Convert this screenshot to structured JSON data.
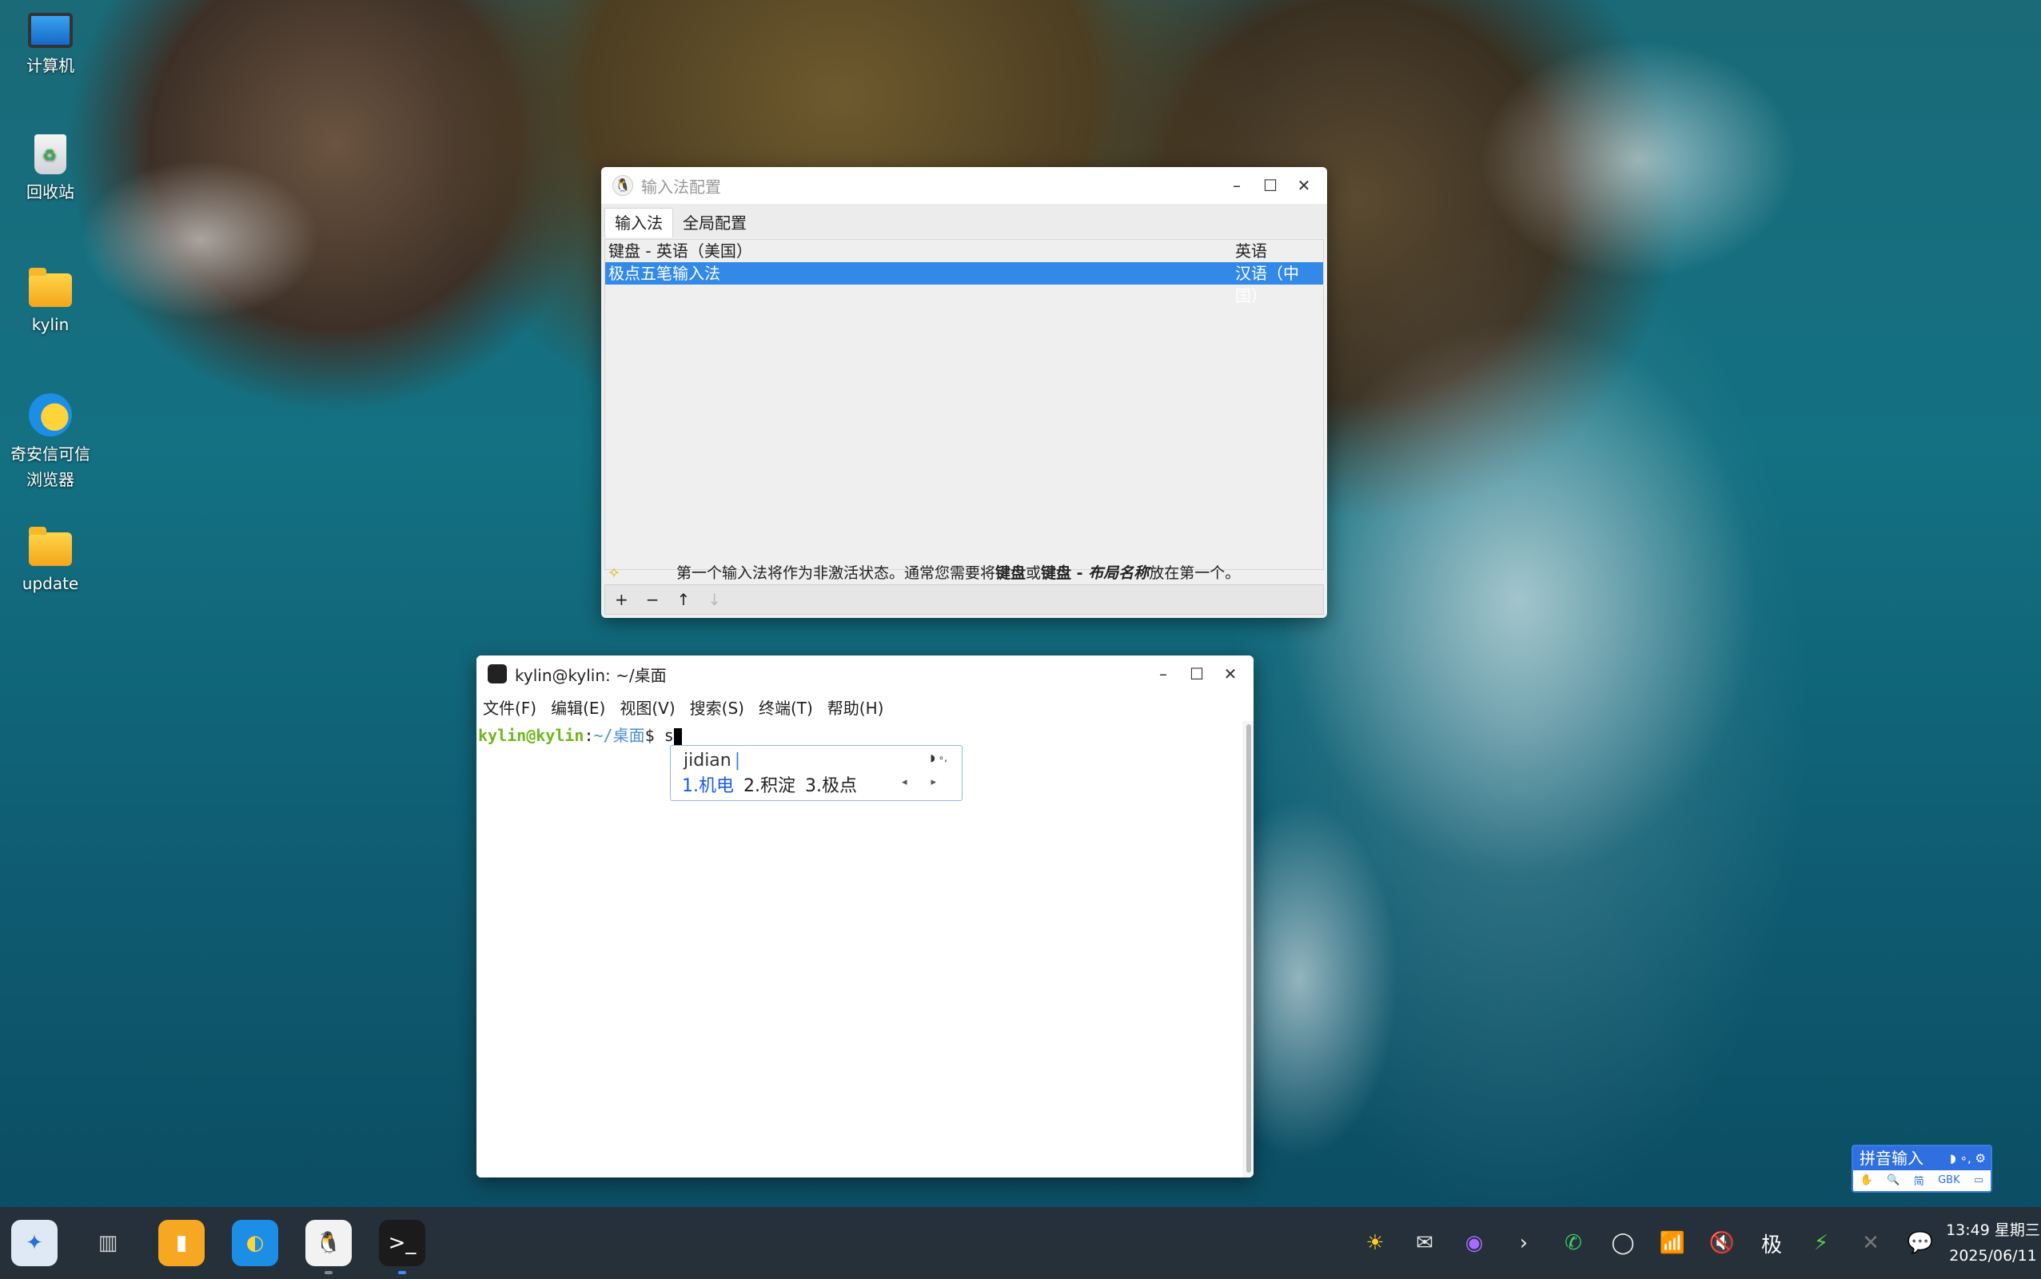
{
  "desktop": {
    "icons": [
      {
        "label": "计算机",
        "icon": "computer-icon"
      },
      {
        "label": "回收站",
        "icon": "trash-icon"
      },
      {
        "label": "kylin",
        "icon": "folder-icon"
      },
      {
        "label": "奇安信可信\n浏览器",
        "icon": "browser-icon"
      },
      {
        "label": "update",
        "icon": "folder-icon"
      }
    ]
  },
  "im_config": {
    "title": "输入法配置",
    "tabs": [
      "输入法",
      "全局配置"
    ],
    "rows": [
      {
        "name": "键盘 - 英语（美国）",
        "lang": "英语"
      },
      {
        "name": "极点五笔输入法",
        "lang": "汉语（中国）"
      }
    ],
    "hint_prefix": "第一个输入法将作为非激活状态。通常您需要将",
    "hint_b1": "键盘",
    "hint_mid": "或",
    "hint_b2": "键盘 - ",
    "hint_bi": "布局名称",
    "hint_suffix": "放在第一个。",
    "tools": [
      "+",
      "−",
      "↑",
      "↓"
    ],
    "buttons": {
      "minimize": "–",
      "maximize": "☐",
      "close": "✕"
    }
  },
  "terminal": {
    "title": "kylin@kylin: ~/桌面",
    "menu": [
      "文件(F)",
      "编辑(E)",
      "视图(V)",
      "搜索(S)",
      "终端(T)",
      "帮助(H)"
    ],
    "prompt_user": "kylin@kylin",
    "prompt_sep": ":",
    "prompt_path": "~/桌面",
    "prompt_symbol": "$ ",
    "input": "s"
  },
  "candidate": {
    "pinyin": "jidian",
    "items": [
      "1.机电",
      "2.积淀",
      "3.极点"
    ],
    "arrow_prev": "◂",
    "arrow_next": "▸",
    "mini_icons": "◗ ∘,"
  },
  "ime_bar": {
    "mode": "拼音输入",
    "top_icons": "◗ ∘, ⚙",
    "bottom": [
      "✋",
      "🔍",
      "简",
      "GBK",
      "▭"
    ]
  },
  "taskbar": {
    "apps": [
      {
        "name": "start-menu-icon",
        "glyph": "✦",
        "bg": "#dfe9f5",
        "fg": "#2b6fd6"
      },
      {
        "name": "multitask-view-icon",
        "glyph": "▥",
        "bg": "transparent",
        "fg": "#cfcfcf"
      },
      {
        "name": "file-manager-icon",
        "glyph": "▮",
        "bg": "#f7a823",
        "fg": "#fff"
      },
      {
        "name": "browser-icon",
        "glyph": "◐",
        "bg": "#1c8ee6",
        "fg": "#ffd33a"
      },
      {
        "name": "im-config-icon",
        "glyph": "🐧",
        "bg": "#f2f2f2",
        "fg": "#000"
      },
      {
        "name": "terminal-icon",
        "glyph": ">_",
        "bg": "#1b1b1b",
        "fg": "#fff"
      }
    ],
    "tray": [
      "☀",
      "✉",
      "◉",
      "›",
      "✆",
      "◯",
      "📶",
      "🔇",
      "极",
      "⚡",
      "✕",
      "💬"
    ],
    "time": "13:49 星期三",
    "date": "2025/06/11"
  }
}
